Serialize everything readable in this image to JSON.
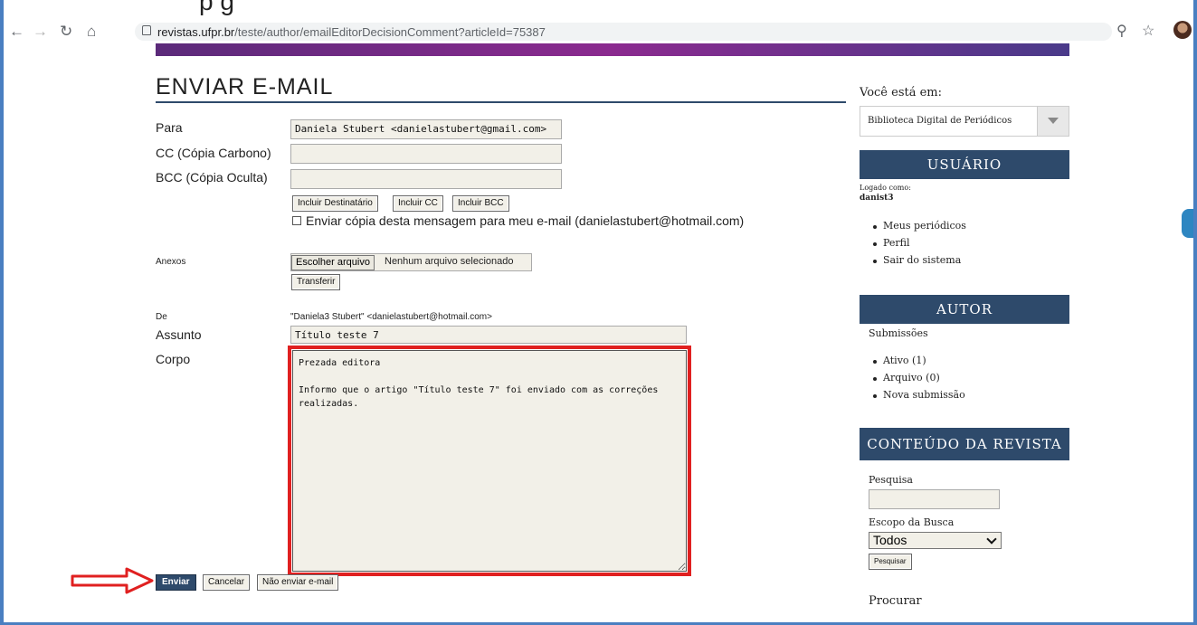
{
  "browser": {
    "url_host": "revistas.ufpr.br",
    "url_path": "/teste/author/emailEditorDecisionComment?articleId=75387",
    "top_cut_text": "p                        g"
  },
  "form": {
    "title": "ENVIAR E-MAIL",
    "to_label": "Para",
    "to_value": "Daniela Stubert <danielastubert@gmail.com>",
    "cc_label": "CC (Cópia Carbono)",
    "cc_value": "",
    "bcc_label": "BCC (Cópia Oculta)",
    "bcc_value": "",
    "btn_add_recipient": "Incluir Destinatário",
    "btn_add_cc": "Incluir CC",
    "btn_add_bcc": "Incluir BCC",
    "copy_checkbox_label": "Enviar cópia desta mensagem para meu e-mail (danielastubert@hotmail.com)",
    "attachments_label": "Anexos",
    "choose_file": "Escolher arquivo",
    "no_file": "Nenhum arquivo selecionado",
    "upload": "Transferir",
    "from_label": "De",
    "from_value": "\"Daniela3 Stubert\" <danielastubert@hotmail.com>",
    "subject_label": "Assunto",
    "subject_value": "Título teste 7",
    "body_label": "Corpo",
    "body_value": "Prezada editora\n\nInformo que o artigo \"Título teste 7\" foi enviado com as correções\nrealizadas.",
    "send": "Enviar",
    "cancel": "Cancelar",
    "skip": "Não enviar e-mail"
  },
  "sidebar": {
    "you_are_at": "Você está em:",
    "location_select": "Biblioteca Digital de Periódicos",
    "user_header": "USUÁRIO",
    "logged_as_label": "Logado como:",
    "username": "danist3",
    "user_links": [
      "Meus periódicos",
      "Perfil",
      "Sair do sistema"
    ],
    "author_header": "AUTOR",
    "submissions_label": "Submissões",
    "author_links": [
      "Ativo (1)",
      "Arquivo (0)",
      "Nova submissão"
    ],
    "content_header": "CONTEÚDO DA REVISTA",
    "search_label": "Pesquisa",
    "scope_label": "Escopo da Busca",
    "scope_value": "Todos",
    "search_button": "Pesquisar",
    "browse_label": "Procurar"
  },
  "colors": {
    "accent_navy": "#2e4a6b",
    "highlight_red": "#e02020",
    "frame_blue": "#4a7fc1"
  }
}
